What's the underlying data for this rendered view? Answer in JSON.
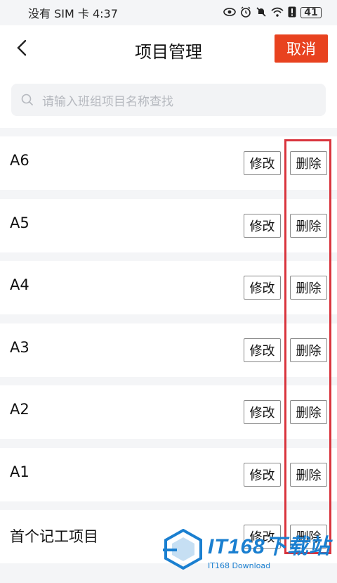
{
  "status_bar": {
    "left_text": "没有 SIM 卡 4:37",
    "battery": "41",
    "icons": [
      "eye-icon",
      "alarm-icon",
      "mute-icon",
      "wifi-icon",
      "alert-icon",
      "battery-icon"
    ]
  },
  "header": {
    "title": "项目管理",
    "cancel_label": "取消",
    "accent_color": "#e8421f"
  },
  "search": {
    "placeholder": "请输入班组项目名称查找"
  },
  "projects": [
    {
      "name": "A6",
      "edit_label": "修改",
      "delete_label": "删除"
    },
    {
      "name": "A5",
      "edit_label": "修改",
      "delete_label": "删除"
    },
    {
      "name": "A4",
      "edit_label": "修改",
      "delete_label": "删除"
    },
    {
      "name": "A3",
      "edit_label": "修改",
      "delete_label": "删除"
    },
    {
      "name": "A2",
      "edit_label": "修改",
      "delete_label": "删除"
    },
    {
      "name": "A1",
      "edit_label": "修改",
      "delete_label": "删除"
    },
    {
      "name": "首个记工项目",
      "edit_label": "修改",
      "delete_label": "删除"
    }
  ],
  "annotation_color": "#d9343d",
  "watermark": {
    "main": "IT168下载站",
    "sub": "IT168 Download"
  }
}
